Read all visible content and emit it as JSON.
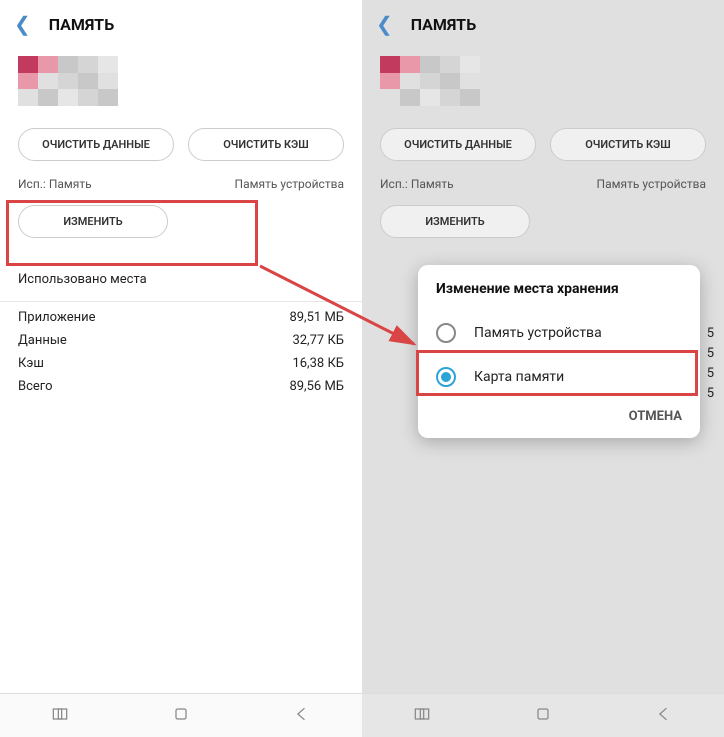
{
  "header": {
    "title": "ПАМЯТЬ"
  },
  "buttons": {
    "clear_data": "ОЧИСТИТЬ ДАННЫЕ",
    "clear_cache": "ОЧИСТИТЬ КЭШ",
    "change": "ИЗМЕНИТЬ"
  },
  "meta": {
    "used_label": "Исп.: Память",
    "storage_label": "Память устройства"
  },
  "section": {
    "used_space": "Использовано места"
  },
  "usage": [
    {
      "label": "Приложение",
      "value": "89,51 МБ"
    },
    {
      "label": "Данные",
      "value": "32,77 КБ"
    },
    {
      "label": "Кэш",
      "value": "16,38 КБ"
    },
    {
      "label": "Всего",
      "value": "89,56 МБ"
    }
  ],
  "dialog": {
    "title": "Изменение места хранения",
    "options": [
      {
        "label": "Память устройства",
        "selected": false
      },
      {
        "label": "Карта памяти",
        "selected": true
      }
    ],
    "cancel": "ОТМЕНА"
  },
  "r_hints": [
    "5",
    "5",
    "5",
    "5"
  ]
}
